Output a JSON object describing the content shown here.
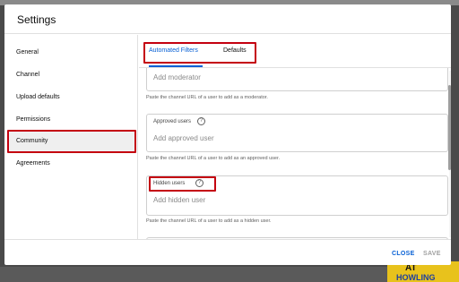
{
  "dialog": {
    "title": "Settings"
  },
  "sidebar": {
    "items": [
      {
        "label": "General"
      },
      {
        "label": "Channel"
      },
      {
        "label": "Upload defaults"
      },
      {
        "label": "Permissions"
      },
      {
        "label": "Community"
      },
      {
        "label": "Agreements"
      }
    ],
    "active": "Community"
  },
  "tabs": [
    {
      "label": "Automated Filters"
    },
    {
      "label": "Defaults"
    }
  ],
  "fields": {
    "moderator": {
      "placeholder": "Add moderator",
      "hint": "Paste the channel URL of a user to add as a moderator."
    },
    "approved": {
      "label": "Approved users",
      "placeholder": "Add approved user",
      "hint": "Paste the channel URL of a user to add as an approved user."
    },
    "hidden": {
      "label": "Hidden users",
      "placeholder": "Add hidden user",
      "hint": "Paste the channel URL of a user to add as a hidden user."
    }
  },
  "icons": {
    "help": "?"
  },
  "footer": {
    "close_label": "CLOSE",
    "save_label": "SAVE"
  },
  "background": {
    "thumb_text": "AT",
    "thumb_sub": "HOWLING"
  },
  "colors": {
    "accent": "#065fd4",
    "highlight": "#c4000f"
  }
}
